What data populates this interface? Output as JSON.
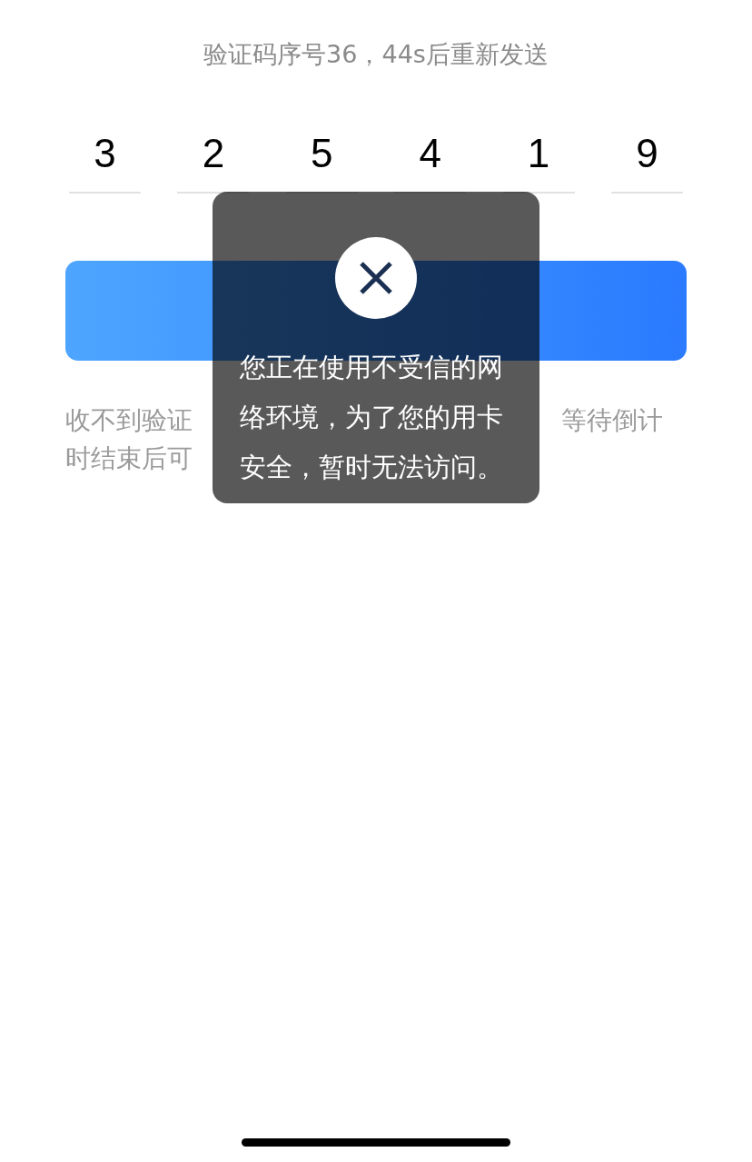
{
  "resend_notice": "验证码序号36，44s后重新发送",
  "code_digits": [
    "3",
    "2",
    "5",
    "4",
    "1",
    "9"
  ],
  "help_text_lines": [
    [
      "收不到验证",
      "等待倒计"
    ],
    [
      "时结束后可"
    ]
  ],
  "toast": {
    "message": "您正在使用不受信的网络环境，为了您的用卡安全，暂时无法访问。"
  }
}
